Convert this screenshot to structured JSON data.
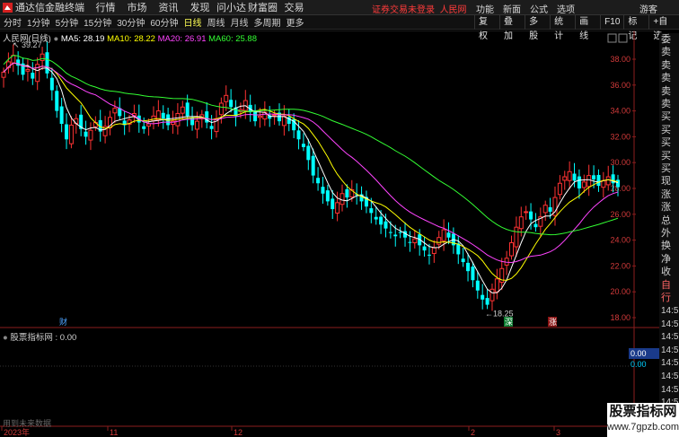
{
  "app": {
    "title": "通达信金融终端"
  },
  "menu": [
    "行情",
    "市场",
    "资讯",
    "发现",
    "问小达",
    "财富圈",
    "交易"
  ],
  "notice": "证券交易未登录",
  "user_label": "人民网",
  "right_menu": [
    "功能",
    "新面",
    "公式",
    "选项"
  ],
  "guest": "游客",
  "periods": [
    "分时",
    "1分钟",
    "5分钟",
    "15分钟",
    "30分钟",
    "60分钟",
    "日线",
    "周线",
    "月线",
    "多周期",
    "更多"
  ],
  "active_period": "日线",
  "tools": [
    "复权",
    "叠加",
    "多股",
    "统计",
    "画线",
    "F10",
    "标记",
    "+自选"
  ],
  "stock": {
    "name": "人民网(日线)"
  },
  "ma": [
    {
      "label": "MA5: 28.19",
      "color": "#ffffff"
    },
    {
      "label": "MA10: 28.22",
      "color": "#ffff00"
    },
    {
      "label": "MA20: 26.91",
      "color": "#ff44ff"
    },
    {
      "label": "MA60: 25.88",
      "color": "#33ff33"
    }
  ],
  "high_label": "39.27",
  "low_label": "18.25",
  "price_axis": [
    "38.00",
    "36.00",
    "34.00",
    "32.00",
    "30.00",
    "28.00",
    "26.00",
    "24.00",
    "22.00",
    "20.00",
    "18.00"
  ],
  "indicator": {
    "title": "股票指标网 : 0.00",
    "value_a": "0.00",
    "value_b": "0.00"
  },
  "unused_text": "用到未来数据",
  "x_axis": [
    {
      "label": "2023年"
    },
    {
      "label": "11"
    },
    {
      "label": "12"
    },
    {
      "label": "2"
    },
    {
      "label": "3"
    }
  ],
  "markers": {
    "cai": "财",
    "shen": "深",
    "zhang": "涨"
  },
  "side_tabs": [
    "委比",
    "卖五",
    "卖四",
    "卖三",
    "卖二",
    "卖一",
    "买一",
    "买二",
    "买三",
    "买四",
    "买五",
    "现价",
    "涨跌",
    "涨幅",
    "总量",
    "外盘",
    "换手",
    "净资",
    "收益",
    "自动",
    "行情"
  ],
  "time_stamps": [
    "14:56",
    "14:56",
    "14:56",
    "14:56",
    "14:56",
    "14:56",
    "14:56",
    "14:56",
    "14:56"
  ],
  "watermark": {
    "line1": "股票指标网",
    "line2": "www.7gpzb.com"
  },
  "colors": {
    "up": "#ff3333",
    "down": "#00ffff",
    "ma5": "#ffffff",
    "ma10": "#ffff00",
    "ma20": "#ff44ff",
    "ma60": "#33ff33"
  }
}
